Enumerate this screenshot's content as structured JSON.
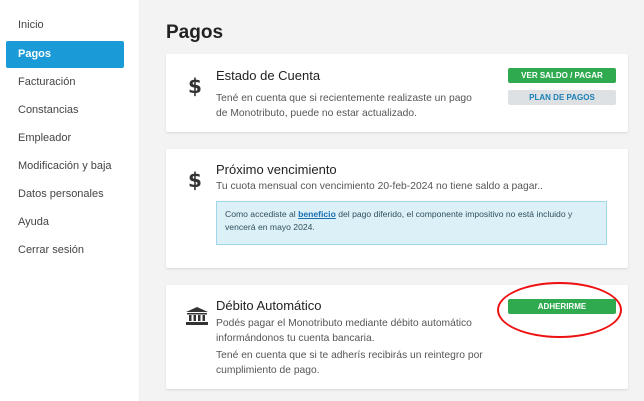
{
  "sidebar": {
    "items": [
      {
        "label": "Inicio"
      },
      {
        "label": "Pagos",
        "active": true
      },
      {
        "label": "Facturación"
      },
      {
        "label": "Constancias"
      },
      {
        "label": "Empleador"
      },
      {
        "label": "Modificación y baja"
      },
      {
        "label": "Datos personales"
      },
      {
        "label": "Ayuda"
      },
      {
        "label": "Cerrar sesión"
      }
    ]
  },
  "page": {
    "title": "Pagos"
  },
  "estado_cuenta": {
    "title": "Estado de Cuenta",
    "text": "Tené en cuenta que si recientemente realizaste un pago de Monotributo, puede no estar actualizado.",
    "btn_primary": "VER SALDO / PAGAR",
    "btn_secondary": "PLAN DE PAGOS",
    "icon": "dollar-icon"
  },
  "proximo_vencimiento": {
    "title": "Próximo vencimiento",
    "text": "Tu cuota mensual con vencimiento 20-feb-2024 no tiene saldo a pagar..",
    "info_prefix": "Como accediste al ",
    "info_link": "beneficio",
    "info_suffix": " del pago diferido, el componente impositivo no está incluido y vencerá en mayo 2024.",
    "icon": "dollar-icon"
  },
  "debito_automatico": {
    "title": "Débito Automático",
    "text1": "Podés pagar el Monotributo mediante débito automático informándonos tu cuenta bancaria.",
    "text2": "Tené en cuenta que si te adherís recibirás un reintegro por cumplimiento de pago.",
    "button": "ADHERIRME",
    "icon": "bank-icon"
  },
  "colors": {
    "accent": "#1a9bd7",
    "success": "#2faa4f",
    "highlight": "#e11111"
  }
}
